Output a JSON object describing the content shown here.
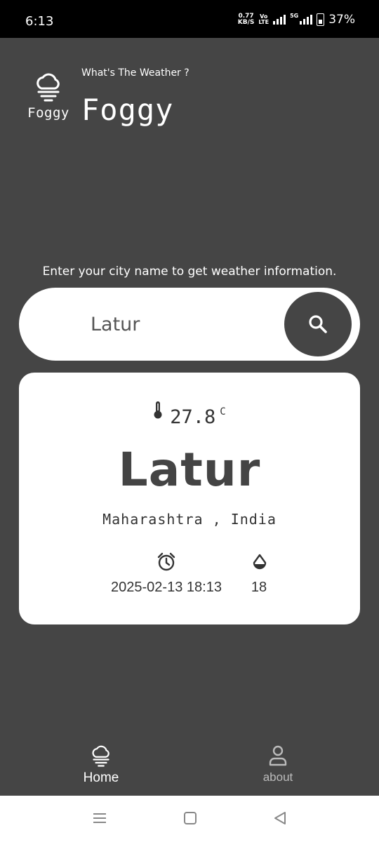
{
  "status_bar": {
    "time": "6:13",
    "net_speed_value": "0.77",
    "net_speed_unit": "KB/S",
    "volte_top": "Vo",
    "volte_bottom": "LTE",
    "network_5g": "5G",
    "battery": "37%"
  },
  "header": {
    "subtitle": "What's The Weather ?",
    "title": "Foggy",
    "logo_text": "Foggy",
    "logo_icon": "foggy-cloud-icon"
  },
  "search": {
    "prompt": "Enter your city name to get weather information.",
    "value": "Latur",
    "button_icon": "search-icon"
  },
  "weather": {
    "temperature": "27.8",
    "unit": "C",
    "city": "Latur",
    "region": "Maharashtra",
    "separator": ",",
    "country": "India",
    "datetime": "2025-02-13 18:13",
    "humidity": "18",
    "icons": [
      "thermometer-icon",
      "alarm-clock-icon",
      "water-drop-icon"
    ]
  },
  "bottom_nav": {
    "home_label": "Home",
    "about_label": "about"
  },
  "colors": {
    "background": "#454545",
    "card": "#ffffff",
    "text_dark": "#333333"
  }
}
